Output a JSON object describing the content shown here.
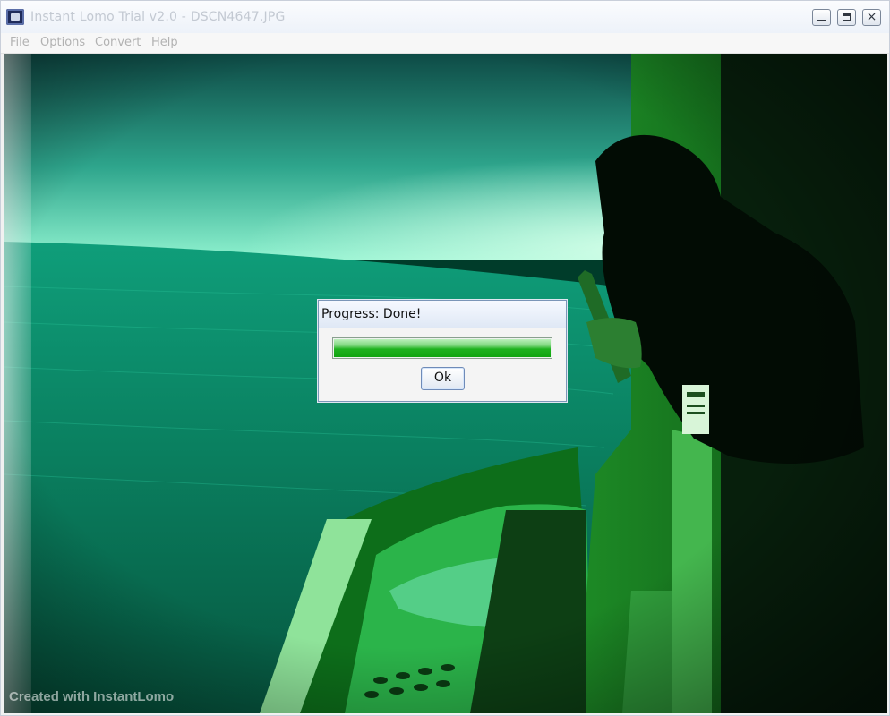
{
  "window": {
    "title": "Instant Lomo Trial v2.0 - DSCN4647.JPG",
    "controls": {
      "minimize": "minimize",
      "maximize": "maximize",
      "close": "×"
    }
  },
  "menu": {
    "items": [
      {
        "label": "File"
      },
      {
        "label": "Options"
      },
      {
        "label": "Convert"
      },
      {
        "label": "Help"
      }
    ]
  },
  "image": {
    "watermark": "Created with InstantLomo",
    "tint": "#00b36b"
  },
  "dialog": {
    "title": "Progress: Done!",
    "progress": 1.0,
    "ok_label": "Ok"
  },
  "colors": {
    "progress_fill": "#14a914",
    "dialog_border": "#7b96b8"
  }
}
